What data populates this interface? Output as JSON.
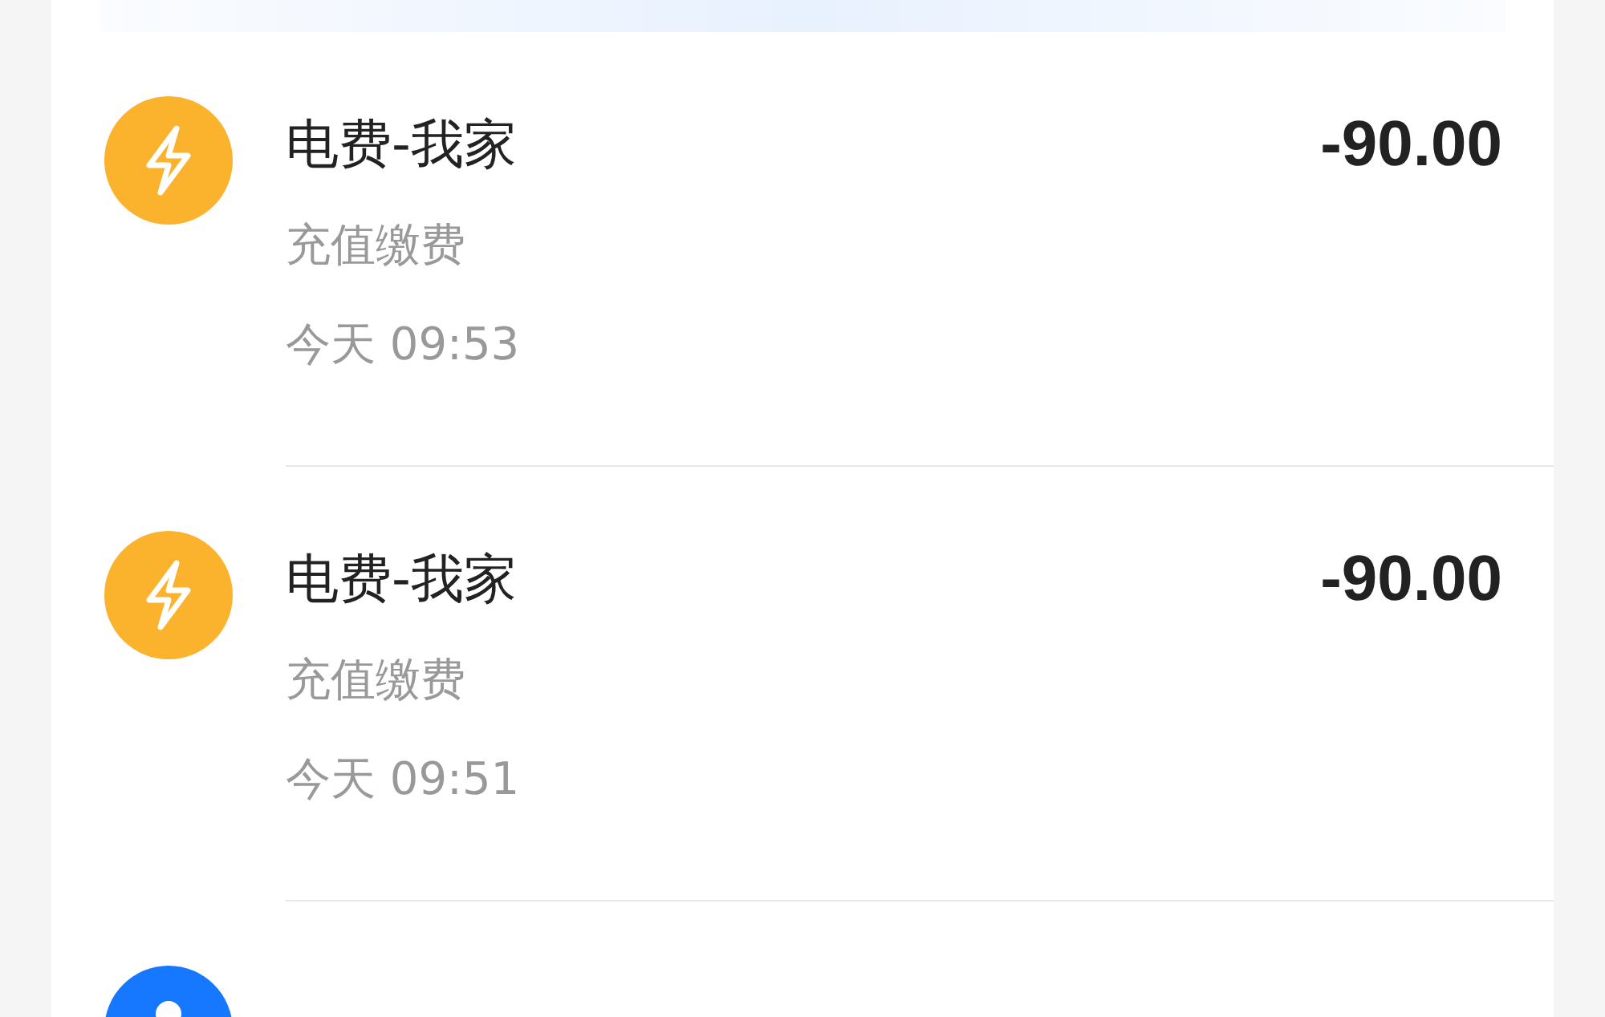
{
  "records": [
    {
      "kind": "electricity",
      "title": "电费-我家",
      "category": "充值缴费",
      "time": "今天 09:53",
      "amount": "-90.00"
    },
    {
      "kind": "electricity",
      "title": "电费-我家",
      "category": "充值缴费",
      "time": "今天 09:51",
      "amount": "-90.00"
    },
    {
      "kind": "huabei"
    }
  ]
}
